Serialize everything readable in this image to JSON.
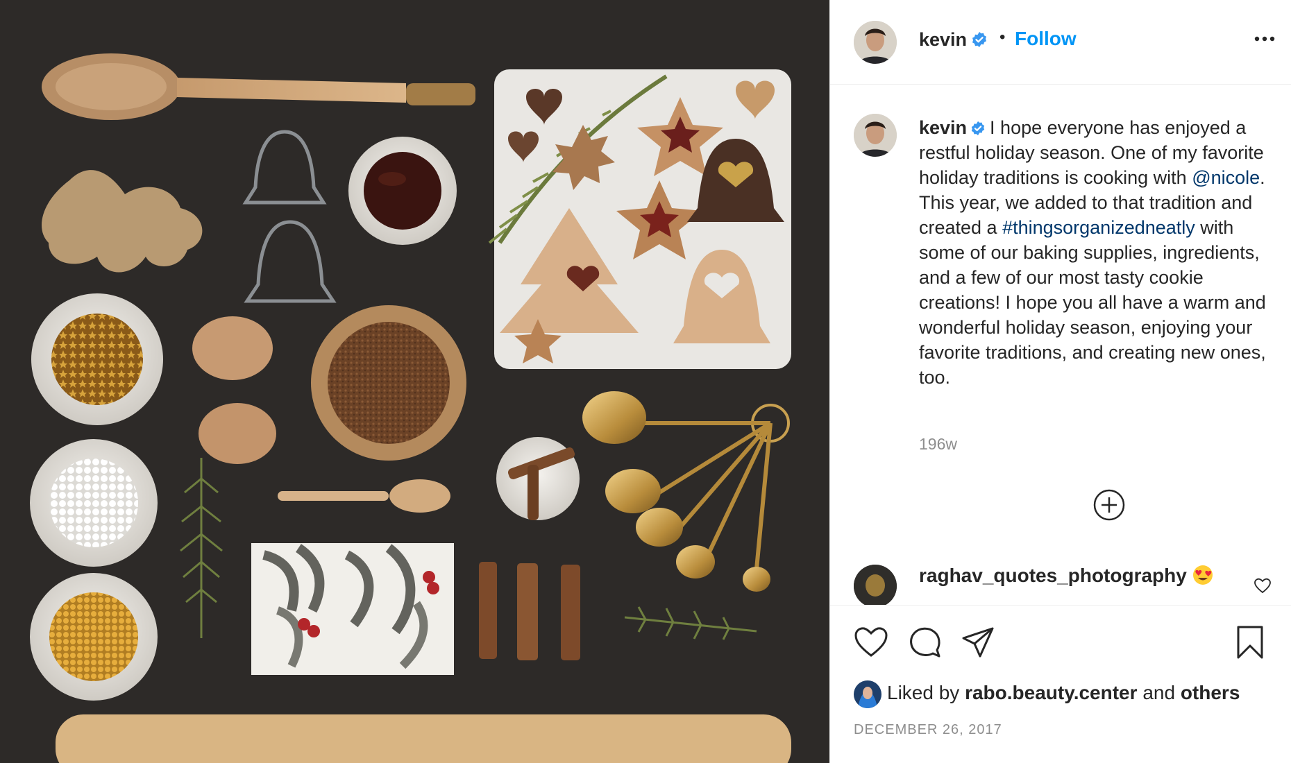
{
  "post_image": {
    "alt": ""
  },
  "header": {
    "username": "kevin",
    "separator": "•",
    "follow_label": "Follow"
  },
  "caption": {
    "username": "kevin",
    "text_before_mention": "I hope everyone has enjoyed a restful holiday season. One of my favorite holiday traditions is cooking with ",
    "mention": "@nicole",
    "text_before_hashtag": ". This year, we added to that tradition and created a ",
    "hashtag": "#thingsorganizedneatly",
    "text_after_hashtag": " with some of our baking supplies, ingredients, and a few of our most tasty cookie creations! I hope you all have a warm and wonderful holiday season, enjoying your favorite traditions, and creating new ones, too.",
    "age": "196w"
  },
  "comment": {
    "username": "raghav_quotes_photography"
  },
  "likes": {
    "prefix": "Liked by",
    "user": "rabo.beauty.center",
    "joiner": "and",
    "others": "others"
  },
  "date": "DECEMBER 26, 2017",
  "colors": {
    "accent": "#0095f6",
    "link": "#00376b",
    "muted": "#8e8e8e",
    "verified": "#3897f0"
  },
  "icons": {
    "more": "ellipsis-icon",
    "load_more": "plus-circle-icon",
    "like": "heart-icon",
    "comment": "comment-bubble-icon",
    "share": "paper-plane-icon",
    "save": "bookmark-icon"
  }
}
